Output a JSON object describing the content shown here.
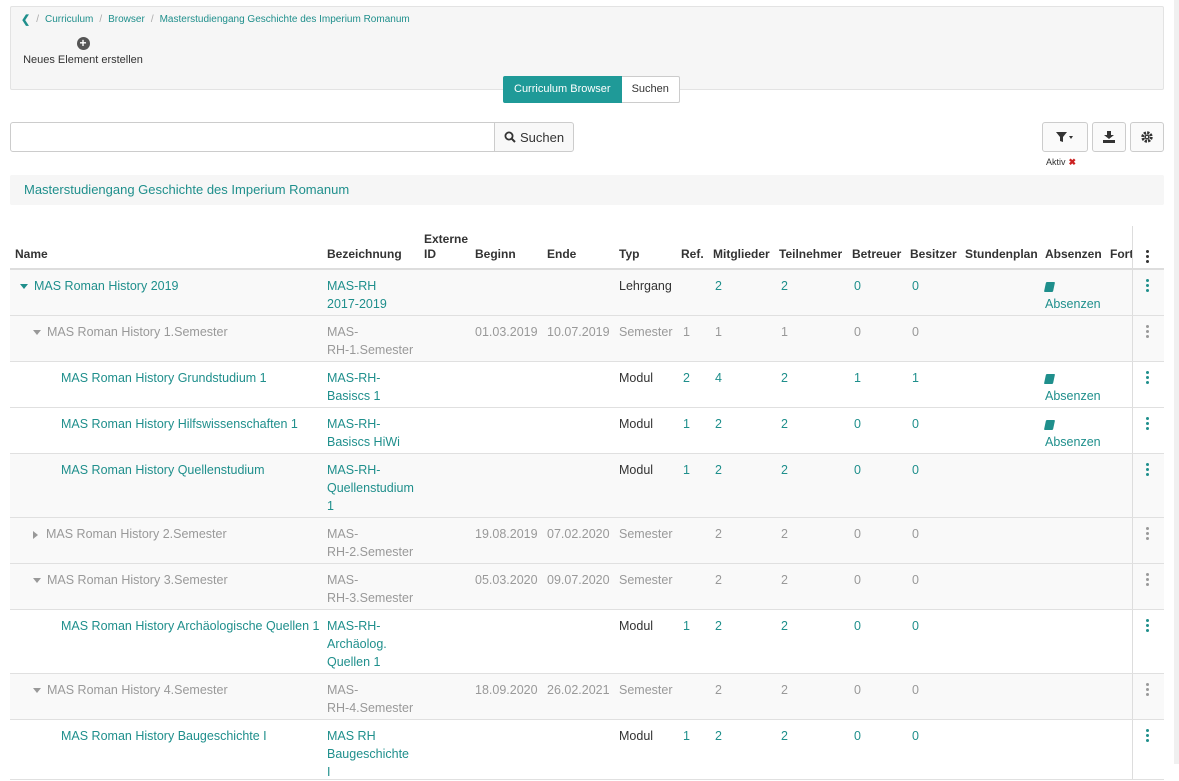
{
  "breadcrumb": [
    "Curriculum",
    "Browser",
    "Masterstudiengang Geschichte des Imperium Romanum"
  ],
  "new_element_label": "Neues Element erstellen",
  "tabs": [
    "Curriculum Browser",
    "Suchen"
  ],
  "search": {
    "value": "",
    "button_label": "Suchen"
  },
  "filter_badge": "Aktiv",
  "context_title": "Masterstudiengang Geschichte des Imperium Romanum",
  "columns": {
    "name": "Name",
    "bezeichnung": "Bezeichnung",
    "externe_1": "Externe",
    "externe_2": "ID",
    "beginn": "Beginn",
    "ende": "Ende",
    "typ": "Typ",
    "ref": "Ref.",
    "mitglieder": "Mitglieder",
    "teilnehmer": "Teilnehmer",
    "betreuer": "Betreuer",
    "besitzer": "Besitzer",
    "stundenplan": "Stundenplan",
    "absenzen": "Absenzen",
    "fort": "Fort"
  },
  "rows": [
    {
      "name": "MAS Roman History 2019",
      "bez": [
        "MAS-RH",
        "2017-2019"
      ],
      "beginn": "",
      "ende": "",
      "typ": "Lehrgang",
      "ref": "",
      "mitglieder": "2",
      "teilnehmer": "2",
      "betreuer": "0",
      "besitzer": "0",
      "absenzen": "Absenzen"
    },
    {
      "name": "MAS Roman History 1.Semester",
      "bez": [
        "MAS-",
        "RH-1.Semester"
      ],
      "beginn": "01.03.2019",
      "ende": "10.07.2019",
      "typ": "Semester",
      "ref": "1",
      "mitglieder": "1",
      "teilnehmer": "1",
      "betreuer": "0",
      "besitzer": "0",
      "absenzen": ""
    },
    {
      "name": "MAS Roman History Grundstudium 1",
      "bez": [
        "MAS-RH-",
        "Basiscs 1"
      ],
      "beginn": "",
      "ende": "",
      "typ": "Modul",
      "ref": "2",
      "mitglieder": "4",
      "teilnehmer": "2",
      "betreuer": "1",
      "besitzer": "1",
      "absenzen": "Absenzen"
    },
    {
      "name": "MAS Roman History Hilfswissenschaften 1",
      "bez": [
        "MAS-RH-",
        "Basiscs HiWi"
      ],
      "beginn": "",
      "ende": "",
      "typ": "Modul",
      "ref": "1",
      "mitglieder": "2",
      "teilnehmer": "2",
      "betreuer": "0",
      "besitzer": "0",
      "absenzen": "Absenzen"
    },
    {
      "name": "MAS Roman History Quellenstudium",
      "bez": [
        "MAS-RH-",
        "Quellenstudium",
        "1"
      ],
      "beginn": "",
      "ende": "",
      "typ": "Modul",
      "ref": "1",
      "mitglieder": "2",
      "teilnehmer": "2",
      "betreuer": "0",
      "besitzer": "0",
      "absenzen": ""
    },
    {
      "name": "MAS Roman History 2.Semester",
      "bez": [
        "MAS-",
        "RH-2.Semester"
      ],
      "beginn": "19.08.2019",
      "ende": "07.02.2020",
      "typ": "Semester",
      "ref": "",
      "mitglieder": "2",
      "teilnehmer": "2",
      "betreuer": "0",
      "besitzer": "0",
      "absenzen": ""
    },
    {
      "name": "MAS Roman History 3.Semester",
      "bez": [
        "MAS-",
        "RH-3.Semester"
      ],
      "beginn": "05.03.2020",
      "ende": "09.07.2020",
      "typ": "Semester",
      "ref": "",
      "mitglieder": "2",
      "teilnehmer": "2",
      "betreuer": "0",
      "besitzer": "0",
      "absenzen": ""
    },
    {
      "name": "MAS Roman History Archäologische Quellen 1",
      "bez": [
        "MAS-RH-",
        "Archäolog.",
        "Quellen 1"
      ],
      "beginn": "",
      "ende": "",
      "typ": "Modul",
      "ref": "1",
      "mitglieder": "2",
      "teilnehmer": "2",
      "betreuer": "0",
      "besitzer": "0",
      "absenzen": ""
    },
    {
      "name": "MAS Roman History 4.Semester",
      "bez": [
        "MAS-",
        "RH-4.Semester"
      ],
      "beginn": "18.09.2020",
      "ende": "26.02.2021",
      "typ": "Semester",
      "ref": "",
      "mitglieder": "2",
      "teilnehmer": "2",
      "betreuer": "0",
      "besitzer": "0",
      "absenzen": ""
    },
    {
      "name": "MAS Roman History Baugeschichte I",
      "bez": [
        "MAS RH",
        "Baugeschichte",
        "I"
      ],
      "beginn": "",
      "ende": "",
      "typ": "Modul",
      "ref": "1",
      "mitglieder": "2",
      "teilnehmer": "2",
      "betreuer": "0",
      "besitzer": "0",
      "absenzen": ""
    }
  ],
  "colors": {
    "accent": "#1f9a98",
    "link": "#1f8f8c",
    "muted": "#999999"
  }
}
